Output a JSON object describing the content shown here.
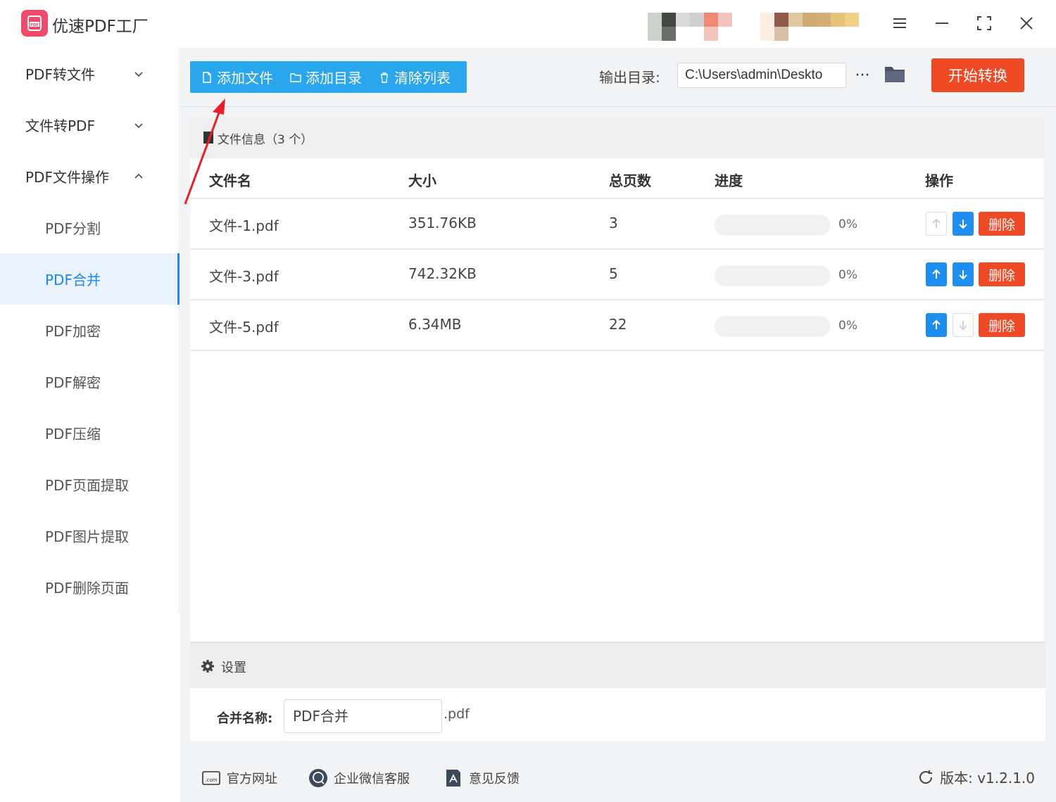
{
  "app": {
    "title": "优速PDF工厂"
  },
  "sidebar": {
    "groups": [
      {
        "label": "PDF转文件"
      },
      {
        "label": "文件转PDF"
      },
      {
        "label": "PDF文件操作"
      }
    ],
    "items": [
      {
        "label": "PDF分割"
      },
      {
        "label": "PDF合并",
        "active": true
      },
      {
        "label": "PDF加密"
      },
      {
        "label": "PDF解密"
      },
      {
        "label": "PDF压缩"
      },
      {
        "label": "PDF页面提取"
      },
      {
        "label": "PDF图片提取"
      },
      {
        "label": "PDF删除页面"
      }
    ]
  },
  "toolbar": {
    "add_file": "添加文件",
    "add_dir": "添加目录",
    "clear_list": "清除列表",
    "output_label": "输出目录:",
    "output_path": "C:\\Users\\admin\\Deskto",
    "more": "···",
    "start": "开始转换"
  },
  "file_panel": {
    "title": "文件信息（3 个）",
    "columns": {
      "name": "文件名",
      "size": "大小",
      "pages": "总页数",
      "progress": "进度",
      "actions": "操作"
    },
    "rows": [
      {
        "name": "文件-1.pdf",
        "size": "351.76KB",
        "pages": "3",
        "progress_text": "0%",
        "progress": 0,
        "up_enabled": false,
        "down_enabled": true,
        "delete": "删除"
      },
      {
        "name": "文件-3.pdf",
        "size": "742.32KB",
        "pages": "5",
        "progress_text": "0%",
        "progress": 0,
        "up_enabled": true,
        "down_enabled": true,
        "delete": "删除"
      },
      {
        "name": "文件-5.pdf",
        "size": "6.34MB",
        "pages": "22",
        "progress_text": "0%",
        "progress": 0,
        "up_enabled": true,
        "down_enabled": false,
        "delete": "删除"
      }
    ]
  },
  "settings": {
    "title": "设置",
    "merge_label": "合并名称:",
    "merge_value": "PDF合并",
    "merge_ext": ".pdf"
  },
  "footer": {
    "website": "官方网址",
    "wechat": "企业微信客服",
    "feedback": "意见反馈",
    "version": "版本: v1.2.1.0"
  },
  "colors": {
    "accent": "#2aa6ee",
    "primary_blue": "#1e8ff0",
    "danger": "#ef4a25",
    "logo": "#ef4c6d",
    "active_nav": "#1e88e5"
  },
  "icons": {
    "logo": "pdf-logo-icon",
    "menu": "menu-icon",
    "minimize": "minimize-icon",
    "fullscreen": "fullscreen-icon",
    "close": "close-icon",
    "folder": "folder-icon",
    "gear": "gear-icon",
    "refresh": "refresh-icon"
  }
}
